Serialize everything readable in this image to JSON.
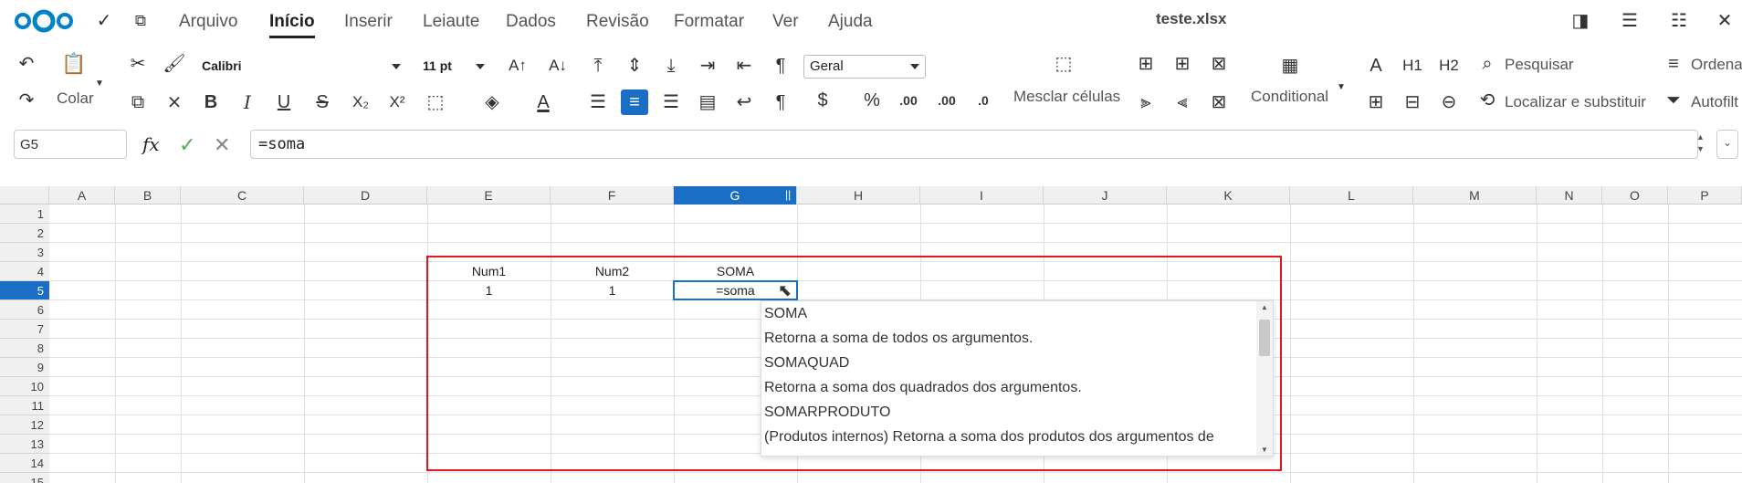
{
  "menubar": {
    "items": [
      {
        "label": "Arquivo"
      },
      {
        "label": "Início"
      },
      {
        "label": "Inserir"
      },
      {
        "label": "Leiaute"
      },
      {
        "label": "Dados"
      },
      {
        "label": "Revisão"
      },
      {
        "label": "Formatar"
      },
      {
        "label": "Ver"
      },
      {
        "label": "Ajuda"
      }
    ],
    "active_index": 1,
    "doc_title": "teste.xlsx"
  },
  "toolbar": {
    "paste_label": "Colar",
    "font_name": "Calibri",
    "font_size": "11 pt",
    "number_format": "Geral",
    "merge_label": "Mesclar células",
    "conditional_label": "Conditional",
    "search_label": "Pesquisar",
    "replace_label": "Localizar e substituir",
    "sort_label": "Ordena",
    "autofilter_label": "Autofilt",
    "h1_label": "H1",
    "h2_label": "H2",
    "a_label": "A"
  },
  "formulabar": {
    "cell_ref": "G5",
    "formula": "=soma"
  },
  "grid": {
    "columns": [
      "A",
      "B",
      "C",
      "D",
      "E",
      "F",
      "G",
      "H",
      "I",
      "J",
      "K",
      "L",
      "M",
      "N",
      "O",
      "P"
    ],
    "rows": [
      "1",
      "2",
      "3",
      "4",
      "5",
      "6",
      "7",
      "8",
      "9",
      "10",
      "11",
      "12",
      "13",
      "14",
      "15"
    ],
    "selected_column": "G",
    "selected_row": "5",
    "cells": {
      "E4": "Num1",
      "F4": "Num2",
      "G4": "SOMA",
      "E5": "1",
      "F5": "1",
      "G5": "=soma"
    }
  },
  "autocomplete": {
    "items": [
      "SOMA",
      "Retorna a soma de todos os argumentos.",
      "SOMAQUAD",
      "Retorna a soma dos quadrados dos argumentos.",
      "SOMARPRODUTO",
      "(Produtos internos) Retorna a soma dos produtos dos argumentos de"
    ]
  },
  "colors": {
    "accent": "#1a6fc4",
    "highlight_border": "#e3161b"
  }
}
